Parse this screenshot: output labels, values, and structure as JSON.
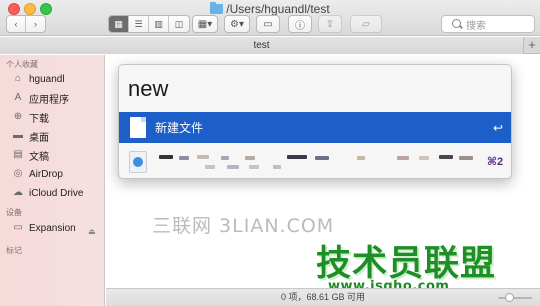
{
  "window": {
    "title": "/Users/hguandl/test",
    "tab_label": "test",
    "tab_add": "+"
  },
  "toolbar": {
    "back_icon": "chevron-left-icon",
    "forward_icon": "chevron-right-icon",
    "view_modes": [
      "icon-view-icon",
      "list-view-icon",
      "column-view-icon",
      "coverflow-view-icon"
    ],
    "arrange_icon": "arrange-icon",
    "action_icon": "gear-icon",
    "search_placeholder": "搜索"
  },
  "sidebar": {
    "favorites_header": "个人收藏",
    "favorites": [
      {
        "label": "hguandl",
        "icon": "home-icon"
      },
      {
        "label": "应用程序",
        "icon": "applications-icon"
      },
      {
        "label": "下载",
        "icon": "download-icon"
      },
      {
        "label": "桌面",
        "icon": "desktop-icon"
      },
      {
        "label": "文稿",
        "icon": "documents-icon"
      },
      {
        "label": "AirDrop",
        "icon": "airdrop-icon"
      },
      {
        "label": "iCloud Drive",
        "icon": "cloud-icon"
      }
    ],
    "devices_header": "设备",
    "devices": [
      {
        "label": "Expansion",
        "icon": "disk-icon"
      }
    ],
    "tags_header": "标记"
  },
  "popup": {
    "query": "new",
    "selected_item": {
      "label": "新建文件",
      "shortcut": "↩"
    },
    "second_item": {
      "shortcut": "⌘2"
    }
  },
  "statusbar": {
    "text": "0 项，68.61 GB 可用"
  },
  "watermark": {
    "line1": "三联网 3LIAN.COM",
    "brand": "技术员联盟",
    "url": "www.jsgho.com"
  },
  "colors": {
    "selection": "#1c5fc8",
    "sidebar_bg": "#f7dada",
    "brand_green": "#1e8f25"
  }
}
